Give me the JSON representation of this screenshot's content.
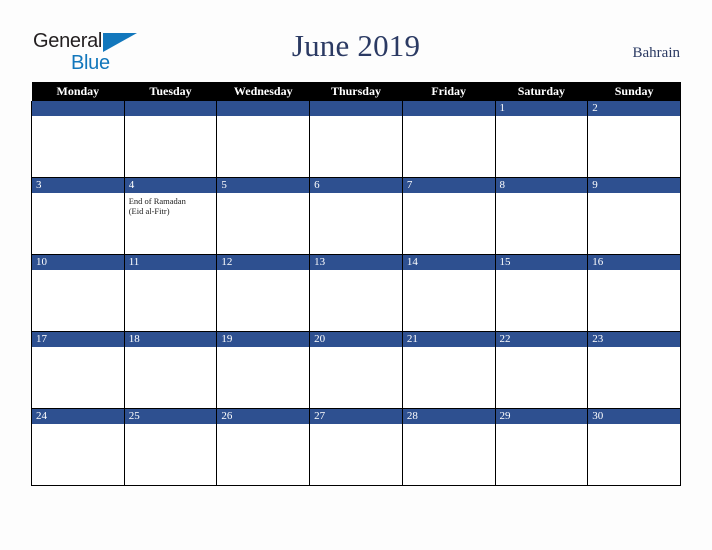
{
  "brand": {
    "name_part1": "General",
    "name_part2": "Blue",
    "triangle_color": "#1277bc",
    "text_color_1": "#231f20",
    "text_color_2": "#1277bc"
  },
  "header": {
    "title": "June 2019",
    "country": "Bahrain",
    "title_color": "#2b3a63"
  },
  "colors": {
    "header_bar": "#000000",
    "day_number_bar": "#2e5090",
    "cell_background": "#ffffff",
    "page_background": "#fdfdfd",
    "grid_line": "#000000"
  },
  "calendar": {
    "weekday_headers": [
      "Monday",
      "Tuesday",
      "Wednesday",
      "Thursday",
      "Friday",
      "Saturday",
      "Sunday"
    ],
    "weeks": [
      [
        {
          "day": "",
          "events": []
        },
        {
          "day": "",
          "events": []
        },
        {
          "day": "",
          "events": []
        },
        {
          "day": "",
          "events": []
        },
        {
          "day": "",
          "events": []
        },
        {
          "day": "1",
          "events": []
        },
        {
          "day": "2",
          "events": []
        }
      ],
      [
        {
          "day": "3",
          "events": []
        },
        {
          "day": "4",
          "events": [
            "End of Ramadan",
            "(Eid al-Fitr)"
          ]
        },
        {
          "day": "5",
          "events": []
        },
        {
          "day": "6",
          "events": []
        },
        {
          "day": "7",
          "events": []
        },
        {
          "day": "8",
          "events": []
        },
        {
          "day": "9",
          "events": []
        }
      ],
      [
        {
          "day": "10",
          "events": []
        },
        {
          "day": "11",
          "events": []
        },
        {
          "day": "12",
          "events": []
        },
        {
          "day": "13",
          "events": []
        },
        {
          "day": "14",
          "events": []
        },
        {
          "day": "15",
          "events": []
        },
        {
          "day": "16",
          "events": []
        }
      ],
      [
        {
          "day": "17",
          "events": []
        },
        {
          "day": "18",
          "events": []
        },
        {
          "day": "19",
          "events": []
        },
        {
          "day": "20",
          "events": []
        },
        {
          "day": "21",
          "events": []
        },
        {
          "day": "22",
          "events": []
        },
        {
          "day": "23",
          "events": []
        }
      ],
      [
        {
          "day": "24",
          "events": []
        },
        {
          "day": "25",
          "events": []
        },
        {
          "day": "26",
          "events": []
        },
        {
          "day": "27",
          "events": []
        },
        {
          "day": "28",
          "events": []
        },
        {
          "day": "29",
          "events": []
        },
        {
          "day": "30",
          "events": []
        }
      ]
    ]
  }
}
